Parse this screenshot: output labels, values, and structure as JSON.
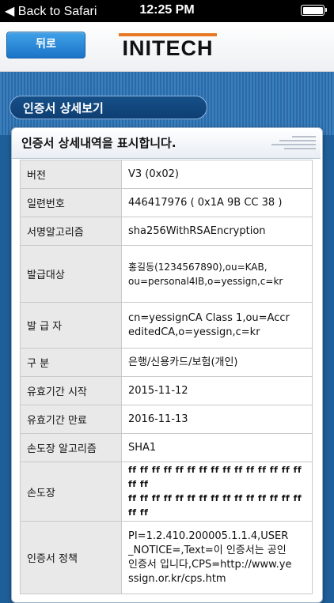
{
  "status_bar": {
    "back_label": "Back to Safari",
    "time": "12:25 PM"
  },
  "header": {
    "back_button": "뒤로",
    "logo_text": "INITECH",
    "colors": {
      "accent": "#e87722",
      "button": "#2a86d6"
    }
  },
  "section_tab": "인증서 상세보기",
  "panel": {
    "title": "인증서 상세내역을 표시합니다."
  },
  "details": [
    {
      "key": "버전",
      "value": "V3 (0x02)"
    },
    {
      "key": "일련번호",
      "value": "446417976 ( 0x1A 9B CC 38 )"
    },
    {
      "key": "서명알고리즘",
      "value": "sha256WithRSAEncryption"
    },
    {
      "key": "발급대상",
      "value_lines": [
        "홍길동(1234567890),ou=KAB,",
        "ou=personal4IB,o=yessign,c=kr"
      ]
    },
    {
      "key": "발 급 자",
      "value_lines": [
        "cn=yessignCA Class 1,ou=Accr",
        "editedCA,o=yessign,c=kr"
      ]
    },
    {
      "key": "구 분",
      "value": "은행/신용카드/보험(개인)"
    },
    {
      "key": "유효기간 시작",
      "value": "2015-11-12"
    },
    {
      "key": "유효기간 만료",
      "value": "2016-11-13"
    },
    {
      "key": "손도장 알고리즘",
      "value": "SHA1"
    },
    {
      "key": "손도장",
      "value_lines": [
        "ff ff ff ff ff ff ff ff ff ff ff ff ff ff ff ff ff",
        "ff ff ff ff ff ff ff ff ff ff ff ff ff ff ff ff ff"
      ]
    },
    {
      "key": "인증서 정책",
      "value_lines": [
        "PI=1.2.410.200005.1.1.4,USER",
        "_NOTICE=,Text=이 인증서는 공인",
        "인증서 입니다,CPS=http://www.ye",
        "ssign.or.kr/cps.htm"
      ]
    }
  ]
}
